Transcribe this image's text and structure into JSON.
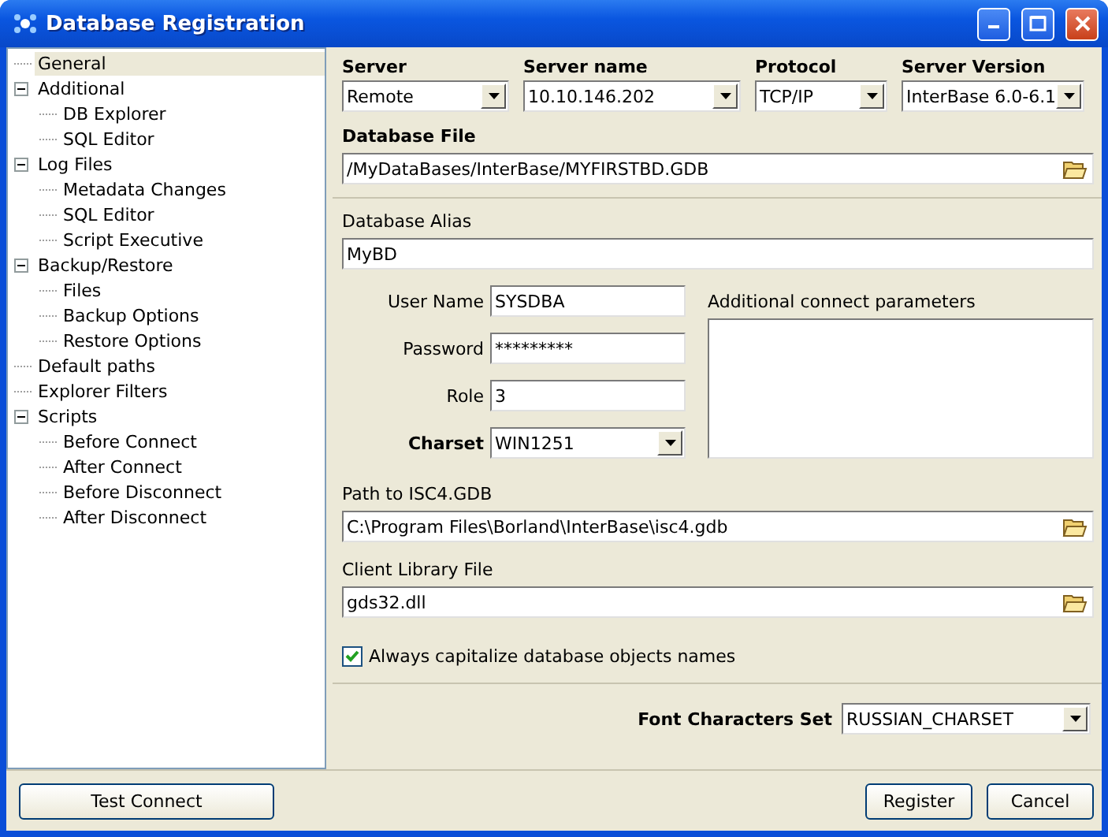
{
  "window": {
    "title": "Database Registration"
  },
  "tree": [
    {
      "label": "General",
      "selected": true
    },
    {
      "label": "Additional",
      "selected": false,
      "expanded": true,
      "children": [
        {
          "label": "DB Explorer",
          "selected": false
        },
        {
          "label": "SQL Editor",
          "selected": false
        }
      ]
    },
    {
      "label": "Log Files",
      "selected": false,
      "expanded": true,
      "children": [
        {
          "label": "Metadata Changes",
          "selected": false
        },
        {
          "label": "SQL Editor",
          "selected": false
        },
        {
          "label": "Script Executive",
          "selected": false
        }
      ]
    },
    {
      "label": "Backup/Restore",
      "selected": false,
      "expanded": true,
      "children": [
        {
          "label": "Files",
          "selected": false
        },
        {
          "label": "Backup Options",
          "selected": false
        },
        {
          "label": "Restore Options",
          "selected": false
        }
      ]
    },
    {
      "label": "Default paths",
      "selected": false
    },
    {
      "label": "Explorer Filters",
      "selected": false
    },
    {
      "label": "Scripts",
      "selected": false,
      "expanded": true,
      "children": [
        {
          "label": "Before Connect",
          "selected": false
        },
        {
          "label": "After Connect",
          "selected": false
        },
        {
          "label": "Before Disconnect",
          "selected": false
        },
        {
          "label": "After Disconnect",
          "selected": false
        }
      ]
    }
  ],
  "server_fields": [
    {
      "label": "Server",
      "value": "Remote"
    },
    {
      "label": "Server name",
      "value": "10.10.146.202"
    },
    {
      "label": "Protocol",
      "value": "TCP/IP"
    },
    {
      "label": "Server Version",
      "value": "InterBase 6.0-6.1"
    }
  ],
  "database_file": {
    "label": "Database File",
    "value": "/MyDataBases/InterBase/MYFIRSTBD.GDB"
  },
  "database_alias": {
    "label": "Database Alias",
    "value": "MyBD"
  },
  "login_fields": [
    {
      "label": "User Name",
      "value": "SYSDBA",
      "kind": "text",
      "bold": false
    },
    {
      "label": "Password",
      "value": "*********",
      "kind": "text",
      "bold": false
    },
    {
      "label": "Role",
      "value": "3",
      "kind": "text",
      "bold": false
    },
    {
      "label": "Charset",
      "value": "WIN1251",
      "kind": "combo",
      "bold": true
    }
  ],
  "additional_params": {
    "label": "Additional connect parameters"
  },
  "path_fields": [
    {
      "label": "Path to ISC4.GDB",
      "value": "C:\\Program Files\\Borland\\InterBase\\isc4.gdb"
    },
    {
      "label": "Client Library File",
      "value": "gds32.dll"
    }
  ],
  "capitalize": {
    "label": "Always capitalize database objects names",
    "checked": true
  },
  "font_charset": {
    "label": "Font Characters Set",
    "value": "RUSSIAN_CHARSET"
  },
  "buttons": {
    "left": "Test Connect",
    "right": [
      "Register",
      "Cancel"
    ]
  }
}
